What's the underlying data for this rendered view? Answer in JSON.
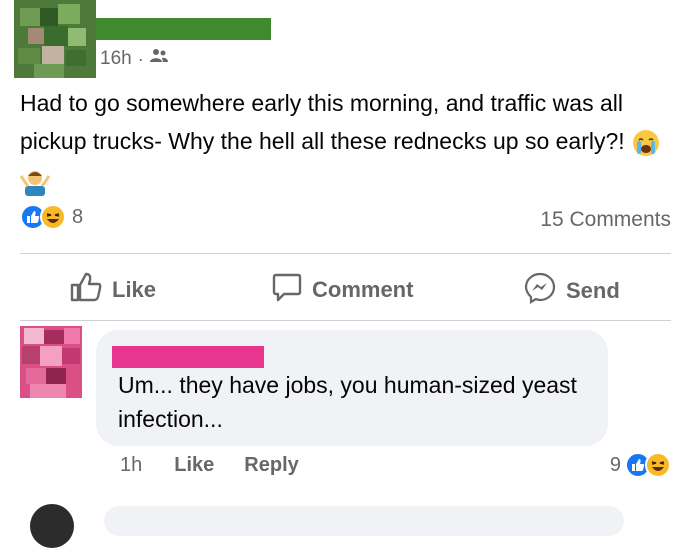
{
  "post": {
    "time": "16h",
    "separator": "·",
    "audience_icon": "friends-icon",
    "text": "Had to go somewhere early this morning, and traffic was all pickup trucks- Why the hell all these rednecks up so early?!",
    "emojis": [
      "loudly-crying-face-icon",
      "person-shrugging-icon"
    ],
    "reaction_icons": [
      "like-reaction-icon",
      "haha-reaction-icon"
    ],
    "reaction_count": "8",
    "comments_count": "15 Comments"
  },
  "actions": {
    "like": "Like",
    "comment": "Comment",
    "send": "Send"
  },
  "comment": {
    "text": "Um... they have jobs, you human-sized yeast infection...",
    "time": "1h",
    "like_label": "Like",
    "reply_label": "Reply",
    "reaction_count": "9",
    "reaction_icons": [
      "like-reaction-icon",
      "haha-reaction-icon"
    ]
  },
  "colors": {
    "like_blue": "#1877f2",
    "haha_yellow": "#f7b928",
    "meta_gray": "#65676b",
    "bubble_gray": "#f0f2f5",
    "post_redaction": "#3f8a2c",
    "comment_redaction": "#e8368f"
  }
}
